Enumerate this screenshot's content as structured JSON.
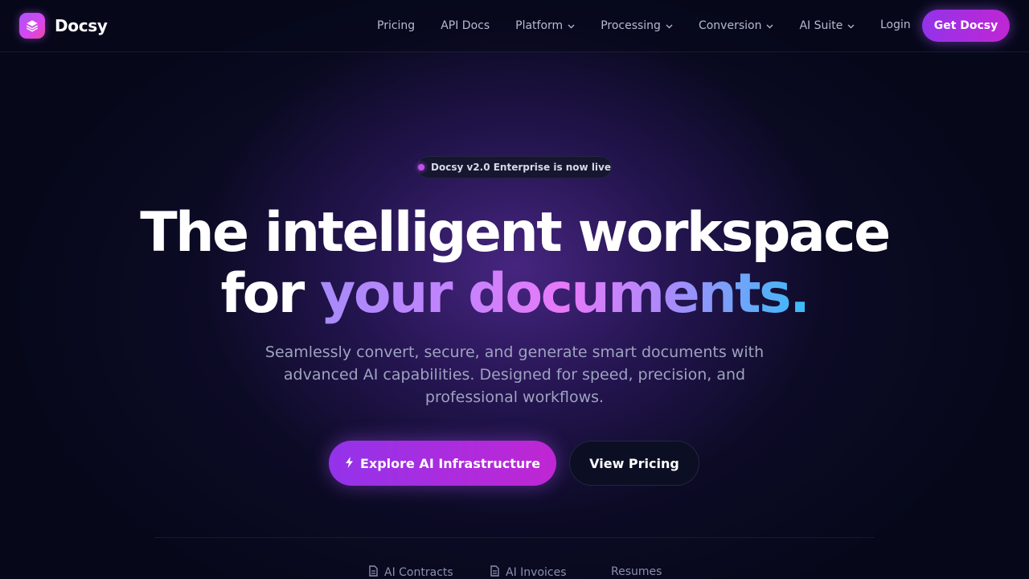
{
  "brand": {
    "name": "Docsy",
    "icon": "layers-icon"
  },
  "nav": {
    "links": [
      {
        "label": "Pricing",
        "dropdown": false
      },
      {
        "label": "API Docs",
        "dropdown": false
      },
      {
        "label": "Platform",
        "dropdown": true
      },
      {
        "label": "Processing",
        "dropdown": true
      },
      {
        "label": "Conversion",
        "dropdown": true
      },
      {
        "label": "AI Suite",
        "dropdown": true
      }
    ],
    "login_label": "Login",
    "cta_label": "Get Docsy"
  },
  "hero": {
    "badge": "Docsy v2.0 Enterprise is now live",
    "headline_line1": "The intelligent workspace",
    "headline_line2_prefix": "for ",
    "headline_line2_highlight": "your documents.",
    "subtitle": "Seamlessly convert, secure, and generate smart documents with advanced AI capabilities. Designed for speed, precision, and professional workflows.",
    "primary_cta": "Explore AI Infrastructure",
    "secondary_cta": "View Pricing"
  },
  "tabs": [
    {
      "label": "AI Contracts",
      "icon": "document-icon"
    },
    {
      "label": "AI Invoices",
      "icon": "document-icon"
    },
    {
      "label": "Resumes",
      "icon": ""
    }
  ],
  "colors": {
    "background": "#06081a",
    "accent": "#9333ea",
    "accent_pink": "#c026d3",
    "muted_text": "#b6bad0"
  }
}
